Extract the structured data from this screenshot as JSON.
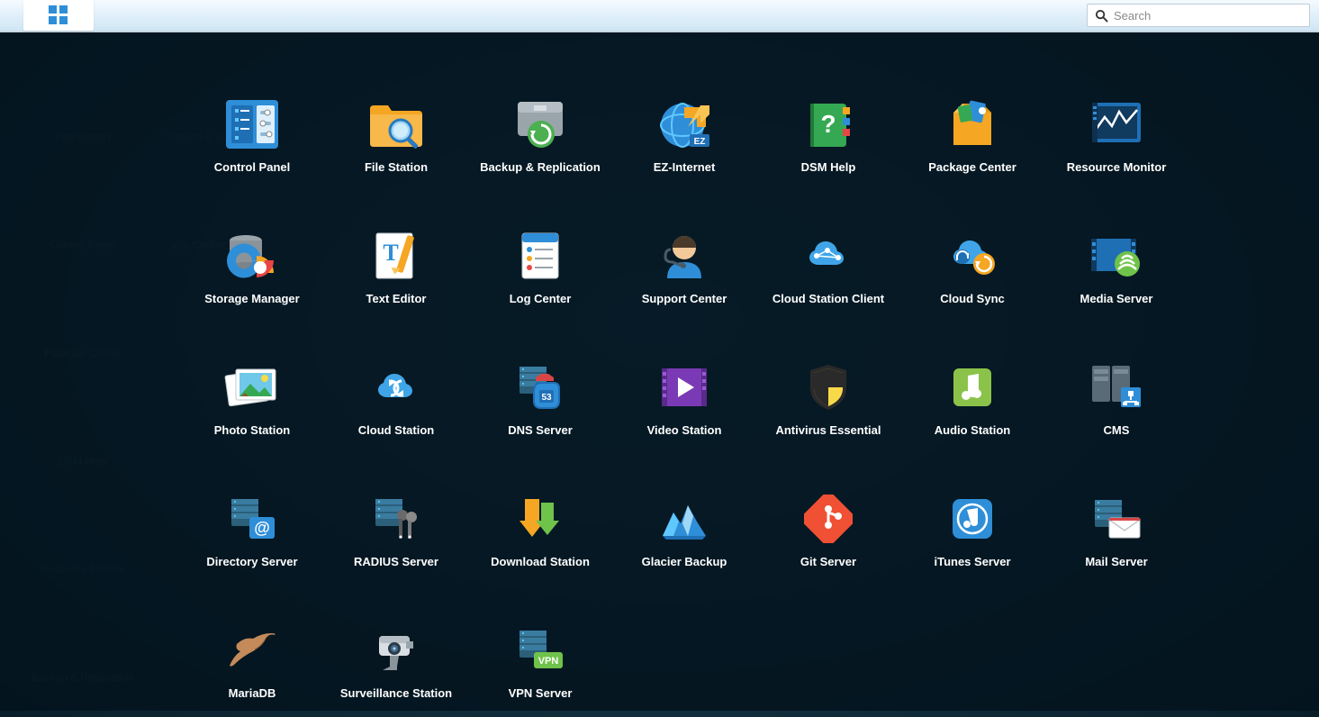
{
  "taskbar": {
    "search_placeholder": "Search"
  },
  "desktop_shortcuts_col1": [
    "File Station",
    "Control Panel",
    "Package Center",
    "DSM Help",
    "Resource Monitor",
    "Backup & Replication"
  ],
  "desktop_shortcuts_col2": [
    "Update & Re",
    "Info Center"
  ],
  "launcher": {
    "apps": [
      {
        "label": "Control Panel",
        "icon": "control-panel"
      },
      {
        "label": "File Station",
        "icon": "folder-search"
      },
      {
        "label": "Backup & Replication",
        "icon": "backup"
      },
      {
        "label": "EZ-Internet",
        "icon": "ez-internet"
      },
      {
        "label": "DSM Help",
        "icon": "help"
      },
      {
        "label": "Package Center",
        "icon": "package"
      },
      {
        "label": "Resource Monitor",
        "icon": "resource"
      },
      {
        "label": "Storage Manager",
        "icon": "storage"
      },
      {
        "label": "Text Editor",
        "icon": "text-editor"
      },
      {
        "label": "Log Center",
        "icon": "log"
      },
      {
        "label": "Support Center",
        "icon": "support"
      },
      {
        "label": "Cloud Station Client",
        "icon": "cloud-client"
      },
      {
        "label": "Cloud Sync",
        "icon": "cloud-sync"
      },
      {
        "label": "Media Server",
        "icon": "media-server"
      },
      {
        "label": "Photo Station",
        "icon": "photo"
      },
      {
        "label": "Cloud Station",
        "icon": "cloud"
      },
      {
        "label": "DNS Server",
        "icon": "dns"
      },
      {
        "label": "Video Station",
        "icon": "video"
      },
      {
        "label": "Antivirus Essential",
        "icon": "antivirus"
      },
      {
        "label": "Audio Station",
        "icon": "audio"
      },
      {
        "label": "CMS",
        "icon": "cms"
      },
      {
        "label": "Directory Server",
        "icon": "directory"
      },
      {
        "label": "RADIUS Server",
        "icon": "radius"
      },
      {
        "label": "Download Station",
        "icon": "download"
      },
      {
        "label": "Glacier Backup",
        "icon": "glacier"
      },
      {
        "label": "Git Server",
        "icon": "git"
      },
      {
        "label": "iTunes Server",
        "icon": "itunes"
      },
      {
        "label": "Mail Server",
        "icon": "mail"
      },
      {
        "label": "MariaDB",
        "icon": "mariadb"
      },
      {
        "label": "Surveillance Station",
        "icon": "surveillance"
      },
      {
        "label": "VPN Server",
        "icon": "vpn"
      }
    ]
  }
}
